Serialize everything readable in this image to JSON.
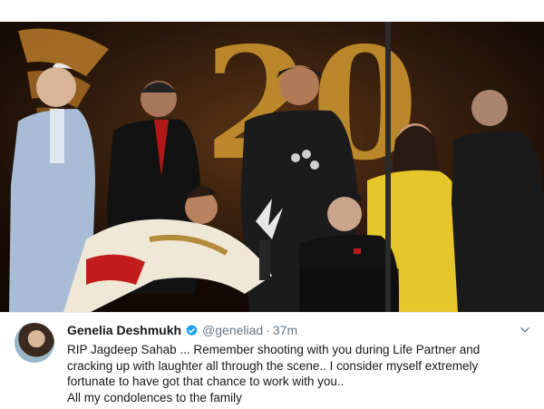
{
  "photo": {
    "alt_scene": "award-ceremony-stage",
    "backdrop_numeral": "20",
    "backdrop_color": "#c8922e"
  },
  "tweet": {
    "author_name": "Genelia Deshmukh",
    "verified_icon": "verified-badge-icon",
    "handle": "@geneliad",
    "separator": "·",
    "time": "37m",
    "lines": [
      "RIP Jagdeep Sahab ... Remember shooting with you during Life Partner and",
      "cracking up with laughter all through the scene.. I consider myself extremely",
      "fortunate to have got that chance to work with you..",
      "All my condolences to the family"
    ],
    "menu_icon": "chevron-down-icon",
    "colors": {
      "name": "#14171a",
      "meta": "#657786",
      "verified": "#1da1f2"
    }
  }
}
